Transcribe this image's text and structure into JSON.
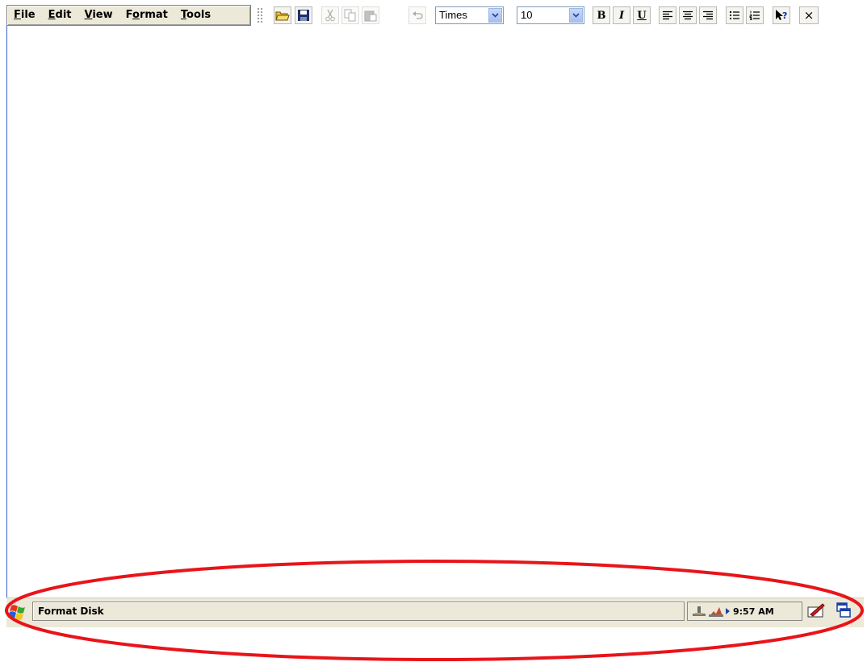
{
  "menu": [
    {
      "label": "File",
      "access": "F",
      "rest": "ile"
    },
    {
      "label": "Edit",
      "access": "E",
      "rest": "dit"
    },
    {
      "label": "View",
      "access": "V",
      "rest": "iew"
    },
    {
      "label": "Format",
      "pre": "F",
      "access": "o",
      "rest": "rmat"
    },
    {
      "label": "Tools",
      "access": "T",
      "rest": "ools"
    }
  ],
  "toolbar": {
    "font_name": "Times",
    "font_size": "10",
    "bold_label": "B",
    "italic_label": "I",
    "underline_label": "U",
    "close_label": "×"
  },
  "taskbar": {
    "active_task": "Format Disk",
    "clock": "9:57 AM"
  },
  "colors": {
    "annotation": "#e8141a",
    "taskbar_bg": "#ece9d8"
  },
  "icons": [
    "open-folder-icon",
    "save-icon",
    "cut-icon",
    "copy-icon",
    "paste-icon",
    "undo-icon",
    "align-left-icon",
    "align-center-icon",
    "align-right-icon",
    "bullets-icon",
    "numbering-icon",
    "help-icon",
    "start-flag-icon",
    "network-icon",
    "connection-icon",
    "input-panel-icon",
    "desktop-icon"
  ]
}
